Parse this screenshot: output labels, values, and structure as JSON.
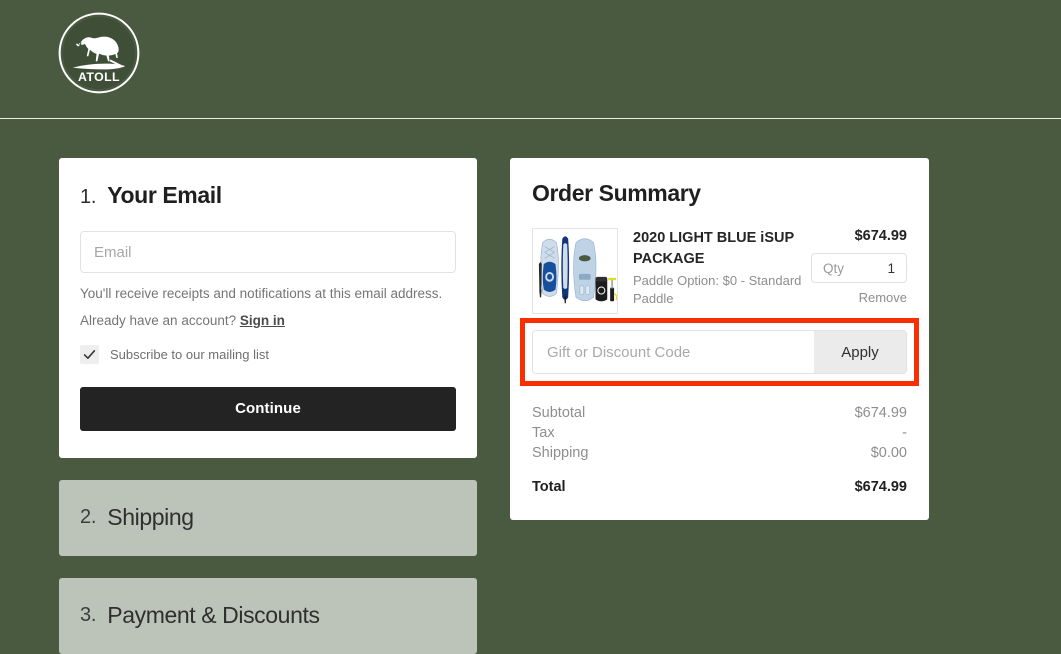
{
  "theme": {
    "page_bg": "#4a5a40",
    "card_bg": "#ffffff",
    "closed_step_bg": "#bcc4b9",
    "button_dark": "#232323",
    "annotation_red": "#f82f00",
    "apply_bg": "#ebebeb"
  },
  "header": {
    "logo_name": "ATOLL",
    "logo_wordmark": "ATOLL"
  },
  "checkout": {
    "step1": {
      "number": "1.",
      "title": "Your Email",
      "email_placeholder": "Email",
      "email_value": "",
      "helper_text": "You'll receive receipts and notifications at this email address.",
      "account_prompt": "Already have an account?",
      "signin_label": "Sign in",
      "subscribe_label": "Subscribe to our mailing list",
      "subscribe_checked": true,
      "continue_label": "Continue"
    },
    "step2": {
      "number": "2.",
      "title": "Shipping"
    },
    "step3": {
      "number": "3.",
      "title": "Payment & Discounts"
    }
  },
  "order_summary": {
    "title": "Order Summary",
    "items": [
      {
        "name": "2020 LIGHT BLUE iSUP PACKAGE",
        "option": "Paddle Option: $0 - Standard Paddle",
        "price": "$674.99",
        "qty_label": "Qty",
        "qty_value": "1",
        "remove_label": "Remove",
        "thumb_name": "isup-package-thumbnail"
      }
    ],
    "discount": {
      "placeholder": "Gift or Discount Code",
      "value": "",
      "apply_label": "Apply",
      "highlighted": true
    },
    "totals": [
      {
        "label": "Subtotal",
        "value": "$674.99"
      },
      {
        "label": "Tax",
        "value": "-"
      },
      {
        "label": "Shipping",
        "value": "$0.00"
      }
    ],
    "grand_total": {
      "label": "Total",
      "value": "$674.99"
    }
  }
}
